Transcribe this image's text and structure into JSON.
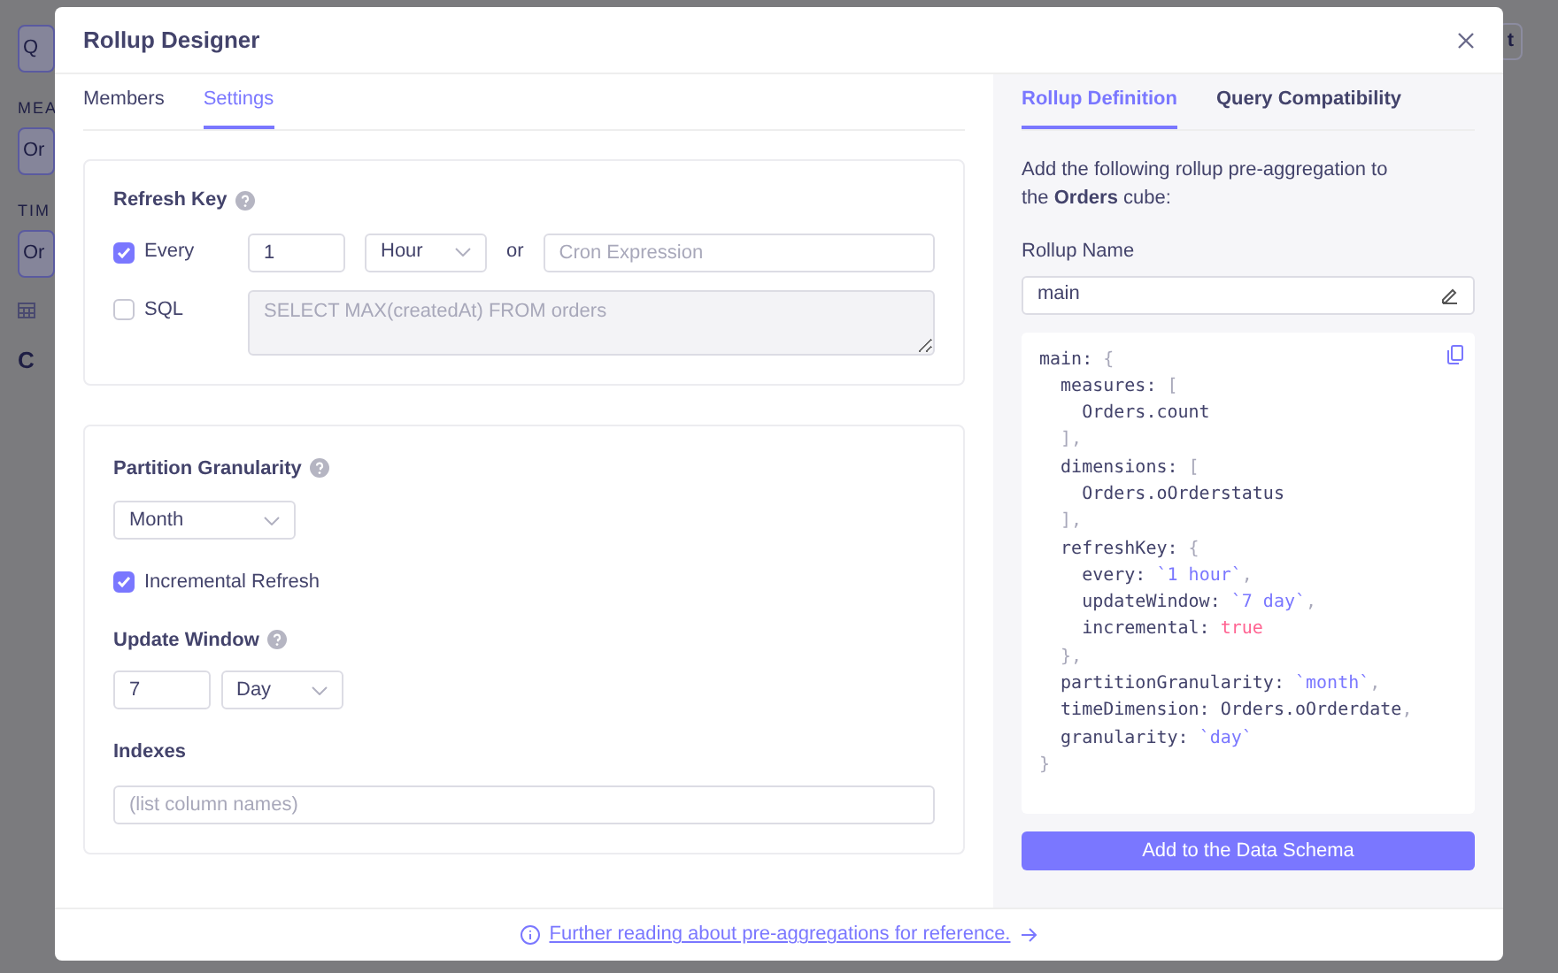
{
  "background": {
    "texts": [
      {
        "kind": "button",
        "text": "Q"
      },
      {
        "kind": "label",
        "text": "MEA"
      },
      {
        "kind": "button",
        "text": "Or"
      },
      {
        "kind": "label",
        "text": "TIM"
      },
      {
        "kind": "button",
        "text": "Or"
      },
      {
        "kind": "icon"
      },
      {
        "kind": "heading",
        "text": "C"
      }
    ],
    "top_right_button": "t"
  },
  "modal": {
    "title": "Rollup Designer",
    "tabs": [
      {
        "label": "Members",
        "selected": false
      },
      {
        "label": "Settings",
        "selected": true
      }
    ],
    "refresh_key": {
      "title": "Refresh Key",
      "every": {
        "label": "Every",
        "checked": true,
        "value": "1",
        "unit": "Hour"
      },
      "or": "or",
      "cron": {
        "placeholder": "Cron Expression"
      },
      "sql": {
        "label": "SQL",
        "checked": false,
        "placeholder": "SELECT MAX(createdAt) FROM orders"
      }
    },
    "partition": {
      "title": "Partition Granularity",
      "value": "Month",
      "incremental": {
        "label": "Incremental Refresh",
        "checked": true
      },
      "update_window": {
        "title": "Update Window",
        "value": "7",
        "unit": "Day"
      },
      "indexes": {
        "title": "Indexes",
        "placeholder": "(list column names)"
      }
    },
    "right_tabs": [
      {
        "label": "Rollup Definition",
        "selected": true
      },
      {
        "label": "Query Compatibility",
        "selected": false
      }
    ],
    "intro": "Add the following rollup pre-aggregation to the **Orders** cube:",
    "rollup_name": {
      "label": "Rollup Name",
      "value": "main"
    },
    "code": [
      [
        {
          "kind": "plain",
          "text": "main: "
        },
        {
          "kind": "punct",
          "text": "{"
        }
      ],
      [
        {
          "kind": "plain",
          "text": "  measures: "
        },
        {
          "kind": "punct",
          "text": "["
        }
      ],
      [
        {
          "kind": "plain",
          "text": "    Orders.count"
        }
      ],
      [
        {
          "kind": "punct",
          "text": "  ],"
        }
      ],
      [
        {
          "kind": "plain",
          "text": "  dimensions: "
        },
        {
          "kind": "punct",
          "text": "["
        }
      ],
      [
        {
          "kind": "plain",
          "text": "    Orders.oOrderstatus"
        }
      ],
      [
        {
          "kind": "punct",
          "text": "  ],"
        }
      ],
      [
        {
          "kind": "plain",
          "text": "  refreshKey: "
        },
        {
          "kind": "punct",
          "text": "{"
        }
      ],
      [
        {
          "kind": "plain",
          "text": "    every: "
        },
        {
          "kind": "string",
          "text": "`1 hour`"
        },
        {
          "kind": "punct",
          "text": ","
        }
      ],
      [
        {
          "kind": "plain",
          "text": "    updateWindow: "
        },
        {
          "kind": "string",
          "text": "`7 day`"
        },
        {
          "kind": "punct",
          "text": ","
        }
      ],
      [
        {
          "kind": "plain",
          "text": "    incremental: "
        },
        {
          "kind": "bool",
          "text": "true"
        }
      ],
      [
        {
          "kind": "punct",
          "text": "  },"
        }
      ],
      [
        {
          "kind": "plain",
          "text": "  partitionGranularity: "
        },
        {
          "kind": "string",
          "text": "`month`"
        },
        {
          "kind": "punct",
          "text": ","
        }
      ],
      [
        {
          "kind": "plain",
          "text": "  timeDimension: Orders.oOrderdate"
        },
        {
          "kind": "punct",
          "text": ","
        }
      ],
      [
        {
          "kind": "plain",
          "text": "  granularity: "
        },
        {
          "kind": "string",
          "text": "`day`"
        }
      ],
      [
        {
          "kind": "punct",
          "text": "}"
        }
      ]
    ],
    "add_button": "Add to the Data Schema",
    "footer_link": "Further reading about pre-aggregations for reference."
  }
}
